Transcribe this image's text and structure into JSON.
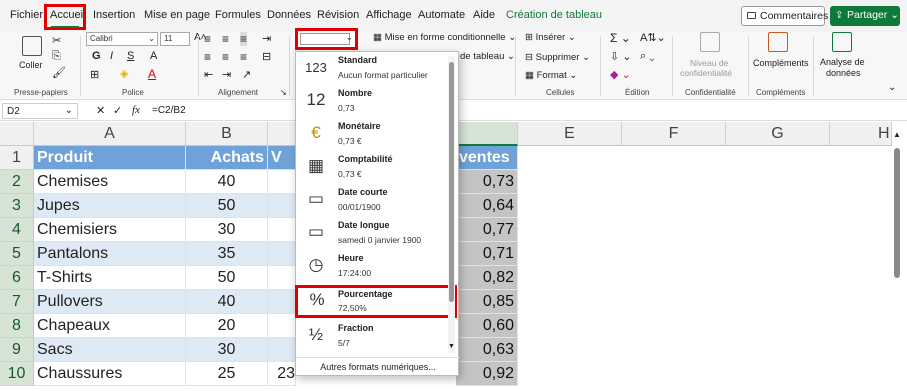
{
  "menubar": {
    "items": [
      "Fichier",
      "Accueil",
      "Insertion",
      "Mise en page",
      "Formules",
      "Données",
      "Révision",
      "Affichage",
      "Automate",
      "Aide",
      "Création de tableau"
    ],
    "comments": "Commentaires",
    "share": "Partager"
  },
  "ribbon": {
    "paste": "Coller",
    "clipboard": "Presse-papiers",
    "font_name": "Calibri",
    "font_size": "11",
    "font_group": "Police",
    "bold": "G",
    "italic": "I",
    "underline": "S",
    "align_group": "Alignement",
    "cond_format": "Mise en forme conditionnelle",
    "table_fmt": "de tableau",
    "insert": "Insérer",
    "delete": "Supprimer",
    "format": "Format",
    "cells_group": "Cellules",
    "edit_group": "Édition",
    "sensitivity_1": "Niveau de",
    "sensitivity_2": "confidentialité",
    "sensitivity_group": "Confidentialité",
    "addins": "Compléments",
    "addins_group": "Compléments",
    "analyze_1": "Analyse de",
    "analyze_2": "données"
  },
  "formula_bar": {
    "name": "D2",
    "fx": "fx",
    "formula": "=C2/B2"
  },
  "columns": [
    "A",
    "B",
    "",
    "",
    "E",
    "F",
    "G",
    "H"
  ],
  "rows": [
    "1",
    "2",
    "3",
    "4",
    "5",
    "6",
    "7",
    "8",
    "9",
    "10"
  ],
  "table": {
    "headers": [
      "Produit",
      "Achats",
      "V",
      "ventes"
    ],
    "data": [
      [
        "Chemises",
        "40",
        "0,73"
      ],
      [
        "Jupes",
        "50",
        "0,64"
      ],
      [
        "Chemisiers",
        "30",
        "0,77"
      ],
      [
        "Pantalons",
        "35",
        "0,71"
      ],
      [
        "T-Shirts",
        "50",
        "0,82"
      ],
      [
        "Pullovers",
        "40",
        "0,85"
      ],
      [
        "Chapeaux",
        "20",
        "0,60"
      ],
      [
        "Sacs",
        "30",
        "0,63"
      ],
      [
        "Chaussures",
        "25",
        "0,92"
      ]
    ],
    "c10_partial": "23"
  },
  "number_formats": [
    {
      "name": "Standard",
      "sample": "Aucun format particulier",
      "icon": "123"
    },
    {
      "name": "Nombre",
      "sample": "0,73",
      "icon": "12"
    },
    {
      "name": "Monétaire",
      "sample": "0,73 €",
      "icon": "€"
    },
    {
      "name": "Comptabilité",
      "sample": " 0,73 €",
      "icon": "▦"
    },
    {
      "name": "Date courte",
      "sample": "00/01/1900",
      "icon": "▭"
    },
    {
      "name": "Date longue",
      "sample": "samedi 0 janvier 1900",
      "icon": "▭"
    },
    {
      "name": "Heure",
      "sample": "17:24:00",
      "icon": "◷"
    },
    {
      "name": "Pourcentage",
      "sample": "72,50%",
      "icon": "%"
    },
    {
      "name": "Fraction",
      "sample": "5/7",
      "icon": "½"
    }
  ],
  "more_formats": "Autres formats numériques...",
  "colors": {
    "accent": "#0e7a3a",
    "highlight": "#e00000",
    "table_header": "#6fa2d9",
    "band": "#dde9f5"
  }
}
